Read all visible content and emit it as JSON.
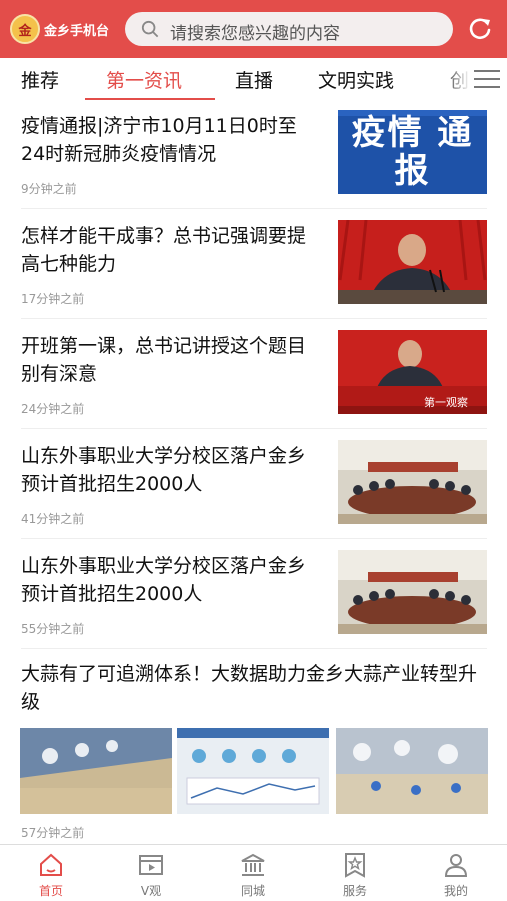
{
  "header": {
    "logo_text": "金乡手机台",
    "search_placeholder": "请搜索您感兴趣的内容"
  },
  "tabs": [
    {
      "label": "推荐"
    },
    {
      "label": "第一资讯"
    },
    {
      "label": "直播"
    },
    {
      "label": "文明实践"
    },
    {
      "label": "创"
    }
  ],
  "news": [
    {
      "title": "疫情通报|济宁市10月11日0时至24时新冠肺炎疫情情况",
      "time": "9分钟之前",
      "thumb_text": "疫情 通报"
    },
    {
      "title": "怎样才能干成事？总书记强调要提高七种能力",
      "time": "17分钟之前"
    },
    {
      "title": "开班第一课，总书记讲授这个题目别有深意",
      "time": "24分钟之前",
      "thumb_caption": "第一观察"
    },
    {
      "title": "山东外事职业大学分校区落户金乡 预计首批招生2000人",
      "time": "41分钟之前"
    },
    {
      "title": "山东外事职业大学分校区落户金乡 预计首批招生2000人",
      "time": "55分钟之前"
    },
    {
      "title": "大蒜有了可追溯体系！大数据助力金乡大蒜产业转型升级",
      "time": "57分钟之前"
    }
  ],
  "bottom_nav": [
    {
      "label": "首页",
      "icon": "home-icon",
      "active": true
    },
    {
      "label": "V观",
      "icon": "video-icon"
    },
    {
      "label": "同城",
      "icon": "building-icon"
    },
    {
      "label": "服务",
      "icon": "star-icon"
    },
    {
      "label": "我的",
      "icon": "user-icon"
    }
  ],
  "colors": {
    "accent": "#e34d4a"
  }
}
